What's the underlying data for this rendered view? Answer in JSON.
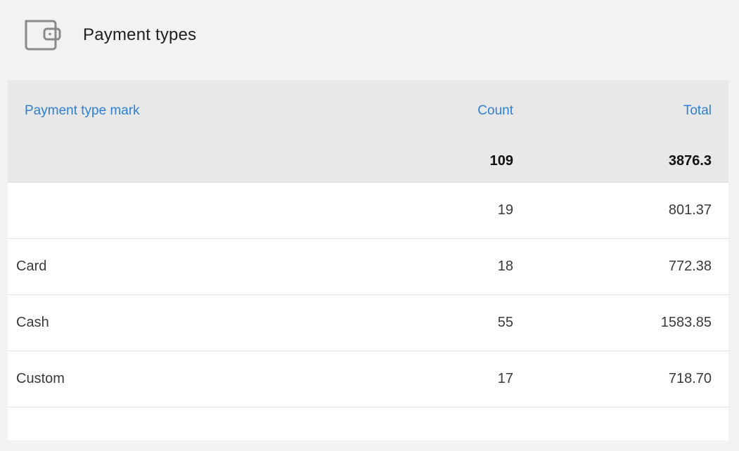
{
  "header": {
    "title": "Payment types",
    "icon": "wallet-icon"
  },
  "table": {
    "columns": {
      "name": "Payment type mark",
      "count": "Count",
      "total": "Total"
    },
    "totals": {
      "count": "109",
      "total": "3876.3"
    },
    "rows": [
      {
        "name": "",
        "count": "19",
        "total": "801.37"
      },
      {
        "name": "Card",
        "count": "18",
        "total": "772.38"
      },
      {
        "name": "Cash",
        "count": "55",
        "total": "1583.85"
      },
      {
        "name": "Custom",
        "count": "17",
        "total": "718.70"
      }
    ]
  },
  "colors": {
    "background": "#f2f2f2",
    "header_bg": "#e8e8e8",
    "link": "#2f7fd6",
    "icon": "#8a8a8a"
  }
}
